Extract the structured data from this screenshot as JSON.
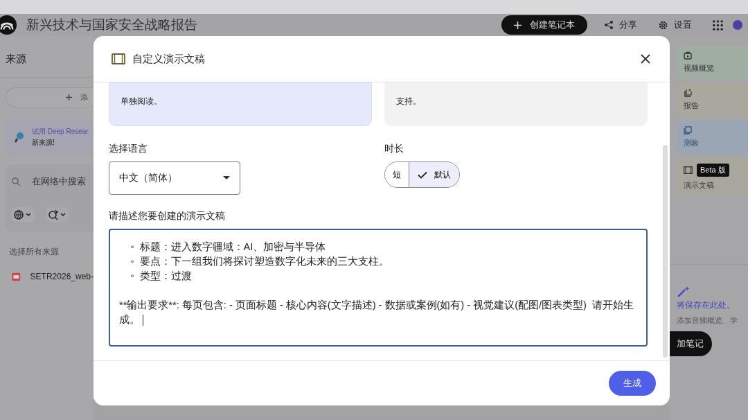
{
  "app_header": {
    "title": "新兴技术与国家安全战略报告",
    "create_button": "创建笔记本",
    "share": "分享",
    "settings": "设置"
  },
  "sources_panel": {
    "title": "来源",
    "add_button": "添",
    "deep_research": {
      "title": "试用 Deep Resear",
      "subtitle": "新来源!"
    },
    "search_placeholder": "在网络中搜索",
    "select_all": "选择所有来源",
    "sources": [
      {
        "name": "SETR2026_web-"
      }
    ]
  },
  "studio_panel": {
    "tools": [
      {
        "label": "视频概览",
        "kind": "video"
      },
      {
        "label": "报告",
        "kind": "report"
      },
      {
        "label": "测验",
        "kind": "quiz"
      },
      {
        "label": "演示文稿",
        "kind": "slides",
        "badge": "Beta 版"
      }
    ],
    "saved_hint": "将保存在此处。",
    "empty_text": "添加音频概览、学",
    "add_note_button": "加笔记"
  },
  "dialog": {
    "title": "自定义演示文稿",
    "format_cards": [
      {
        "text": "单独阅读。",
        "selected": true
      },
      {
        "text": "支持。",
        "selected": false
      }
    ],
    "language": {
      "label": "选择语言",
      "value": "中文（简体）"
    },
    "length": {
      "label": "时长",
      "options": [
        {
          "label": "短",
          "selected": false
        },
        {
          "label": "默认",
          "selected": true
        }
      ]
    },
    "prompt": {
      "label": "请描述您要创建的演示文稿",
      "value": "    ◦  标题：进入数字疆域：AI、加密与半导体\n    ◦  要点：下一组我们将探讨塑造数字化未来的三大支柱。\n    ◦  类型：过渡\n\n**输出要求**: 每页包含: - 页面标题 - 核心内容(文字描述) - 数据或案例(如有) - 视觉建议(配图/图表类型)  请开始生成。"
    },
    "generate_button": "生成"
  }
}
